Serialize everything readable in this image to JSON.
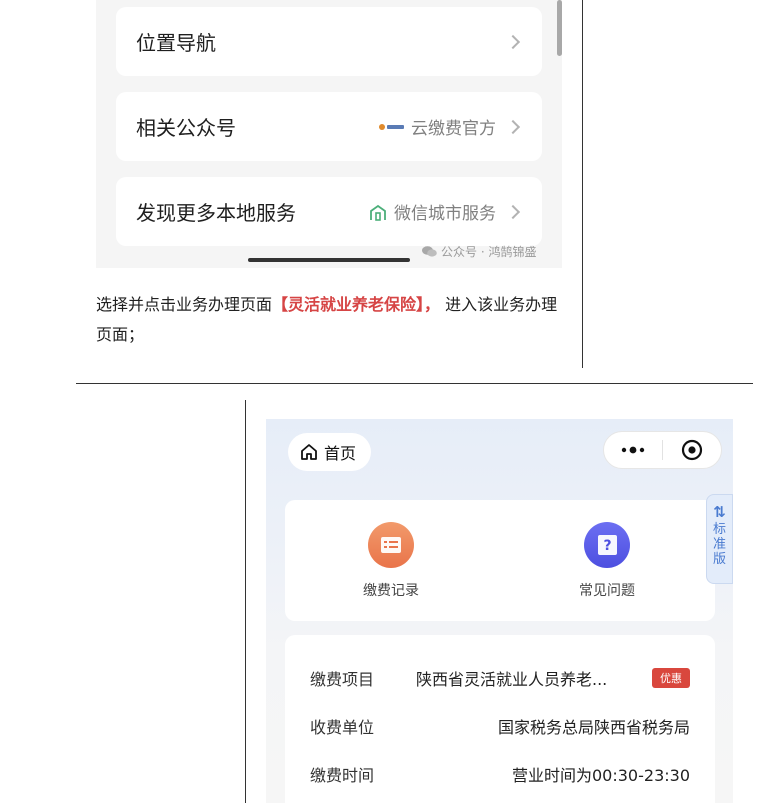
{
  "top_screen": {
    "cards": [
      {
        "title": "位置导航",
        "extra": ""
      },
      {
        "title": "相关公众号",
        "extra": "云缴费官方"
      },
      {
        "title": "发现更多本地服务",
        "extra": "微信城市服务"
      }
    ],
    "watermark": "公众号 · 鸿鹄锦盛"
  },
  "caption": {
    "before": "选择并点击业务办理页面",
    "highlight": "【灵活就业养老保险】，",
    "after": " 进入该业务办理页面；"
  },
  "bottom_screen": {
    "home_label": "首页",
    "std_tab": {
      "swap": "⇅",
      "chars": [
        "标",
        "准",
        "版"
      ]
    },
    "quick_actions": [
      {
        "label": "缴费记录",
        "icon": "list-icon"
      },
      {
        "label": "常见问题",
        "icon": "question-icon"
      }
    ],
    "info_rows": [
      {
        "label": "缴费项目",
        "value": "陕西省灵活就业人员养老...",
        "badge": "优惠"
      },
      {
        "label": "收费单位",
        "value": "国家税务总局陕西省税务局"
      },
      {
        "label": "缴费时间",
        "value": "营业时间为00:30-23:30"
      }
    ]
  },
  "colors": {
    "highlight_red": "#d64545",
    "badge_red": "#d9473d",
    "orange_icon": "#ec7f52",
    "purple_icon": "#5a5cea",
    "std_tab_blue": "#4a7bd0"
  }
}
